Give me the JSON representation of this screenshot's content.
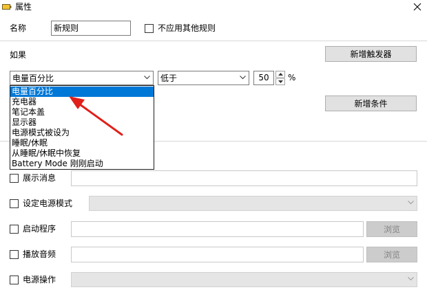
{
  "window": {
    "title": "属性"
  },
  "name_row": {
    "label": "名称",
    "value": "新规则",
    "exclusive_label": "不应用其他规则"
  },
  "conditions": {
    "if_label": "如果",
    "add_trigger_label": "新增触发器",
    "trigger_select": "电量百分比",
    "comparison_select": "低于",
    "threshold_value": "50",
    "unit": "%",
    "add_condition_label": "新增条件"
  },
  "trigger_dropdown": {
    "options": [
      "电量百分比",
      "充电器",
      "笔记本盖",
      "显示器",
      "电源模式被设为",
      "睡眠/休眠",
      "从睡眠/休眠中恢复",
      "Battery Mode 刚刚启动"
    ],
    "selected": "电量百分比"
  },
  "actions": {
    "show_message": {
      "label": "展示消息",
      "value": ""
    },
    "set_power_mode": {
      "label": "设定电源模式",
      "value": ""
    },
    "start_program": {
      "label": "启动程序",
      "value": "",
      "browse_label": "浏览"
    },
    "play_audio": {
      "label": "播放音频",
      "value": "",
      "browse_label": "浏览"
    },
    "power_action": {
      "label": "电源操作",
      "value": ""
    }
  },
  "colors": {
    "selection": "#0078d7",
    "annotation_arrow": "#e0201b"
  }
}
